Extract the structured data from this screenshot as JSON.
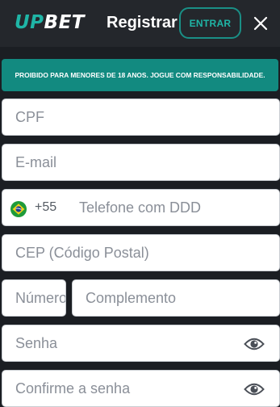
{
  "header": {
    "logo_up": "UP",
    "logo_bet": "BET",
    "title": "Registrar",
    "login_label": "ENTRAR",
    "close_icon": "close-icon"
  },
  "banner": {
    "text": "PROIBIDO PARA MENORES DE 18 ANOS. JOGUE COM RESPONSABILIDADE."
  },
  "form": {
    "cpf_placeholder": "CPF",
    "email_placeholder": "E-mail",
    "phone": {
      "country_icon": "brazil-flag-icon",
      "dial_code": "+55",
      "placeholder": "Telefone com DDD"
    },
    "cep_placeholder": "CEP (Código Postal)",
    "number_placeholder": "Número",
    "complement_placeholder": "Complemento",
    "password_placeholder": "Senha",
    "confirm_password_placeholder": "Confirme a senha",
    "visibility_icon": "eye-icon"
  },
  "colors": {
    "accent": "#1fb5a6",
    "banner": "#128a80",
    "background": "#1b1e23",
    "header": "#24272c"
  }
}
